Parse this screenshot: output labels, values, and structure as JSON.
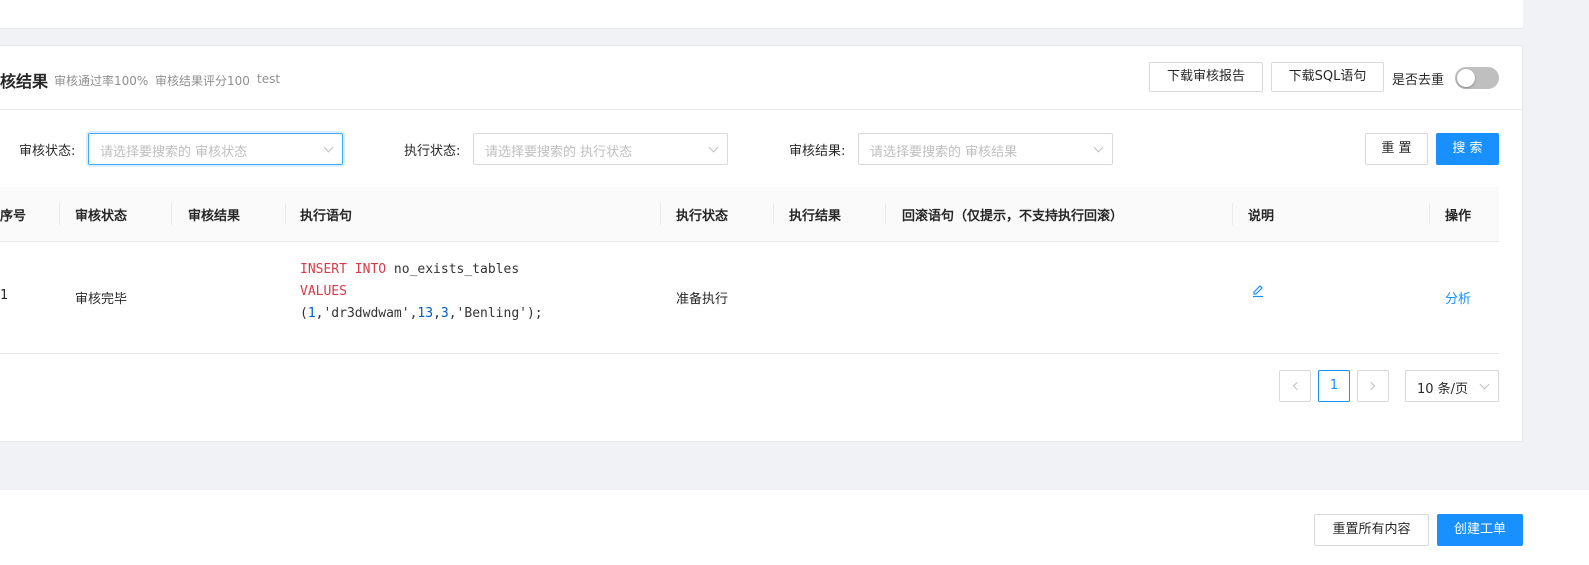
{
  "header": {
    "title": "核结果",
    "pass_rate": "审核通过率100%",
    "score": "审核结果评分100",
    "tag": "test",
    "download_report_label": "下载审核报告",
    "download_sql_label": "下载SQL语句",
    "dedupe_label": "是否去重",
    "dedupe_on": false
  },
  "filters": {
    "audit_status_label": "审核状态:",
    "audit_status_placeholder": "请选择要搜索的 审核状态",
    "exec_status_label": "执行状态:",
    "exec_status_placeholder": "请选择要搜索的 执行状态",
    "audit_result_label": "审核结果:",
    "audit_result_placeholder": "请选择要搜索的 审核结果",
    "reset_label": "重 置",
    "search_label": "搜 索"
  },
  "table": {
    "columns": [
      "序号",
      "审核状态",
      "审核结果",
      "执行语句",
      "执行状态",
      "执行结果",
      "回滚语句（仅提示，不支持执行回滚）",
      "说明",
      "操作"
    ],
    "rows": [
      {
        "index": "1",
        "audit_status": "审核完毕",
        "audit_result": "",
        "sql": {
          "kw1": "INSERT INTO",
          "table": " no_exists_tables",
          "kw2": "VALUES",
          "p_open": "(",
          "v1": "1",
          "c1": ",'dr3dwdwam',",
          "v2": "13",
          "c2": ",",
          "v3": "3",
          "c3": ",'Benling');"
        },
        "exec_status": "准备执行",
        "exec_result": "",
        "rollback": "",
        "action": "分析"
      }
    ]
  },
  "pagination": {
    "current": "1",
    "page_size": "10 条/页"
  },
  "footer": {
    "reset_all_label": "重置所有内容",
    "create_label": "创建工单"
  },
  "colors": {
    "primary": "#1890ff",
    "keyword": "#d73a49",
    "number": "#005cc5"
  }
}
